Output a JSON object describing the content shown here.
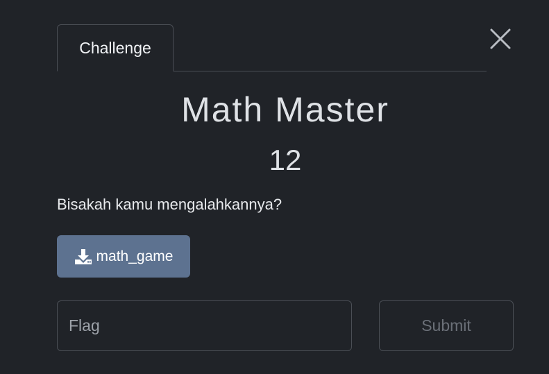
{
  "tabs": [
    {
      "label": "Challenge",
      "active": true
    }
  ],
  "close_icon": "close-icon",
  "challenge": {
    "name": "Math Master",
    "points": "12",
    "description": "Bisakah kamu mengalahkannya?",
    "file_label": "math_game",
    "file_icon": "download-icon"
  },
  "form": {
    "flag_placeholder": "Flag",
    "flag_value": "",
    "submit_label": "Submit"
  },
  "colors": {
    "background": "#202328",
    "file_button": "#5d7290",
    "border": "#4a4e55"
  }
}
